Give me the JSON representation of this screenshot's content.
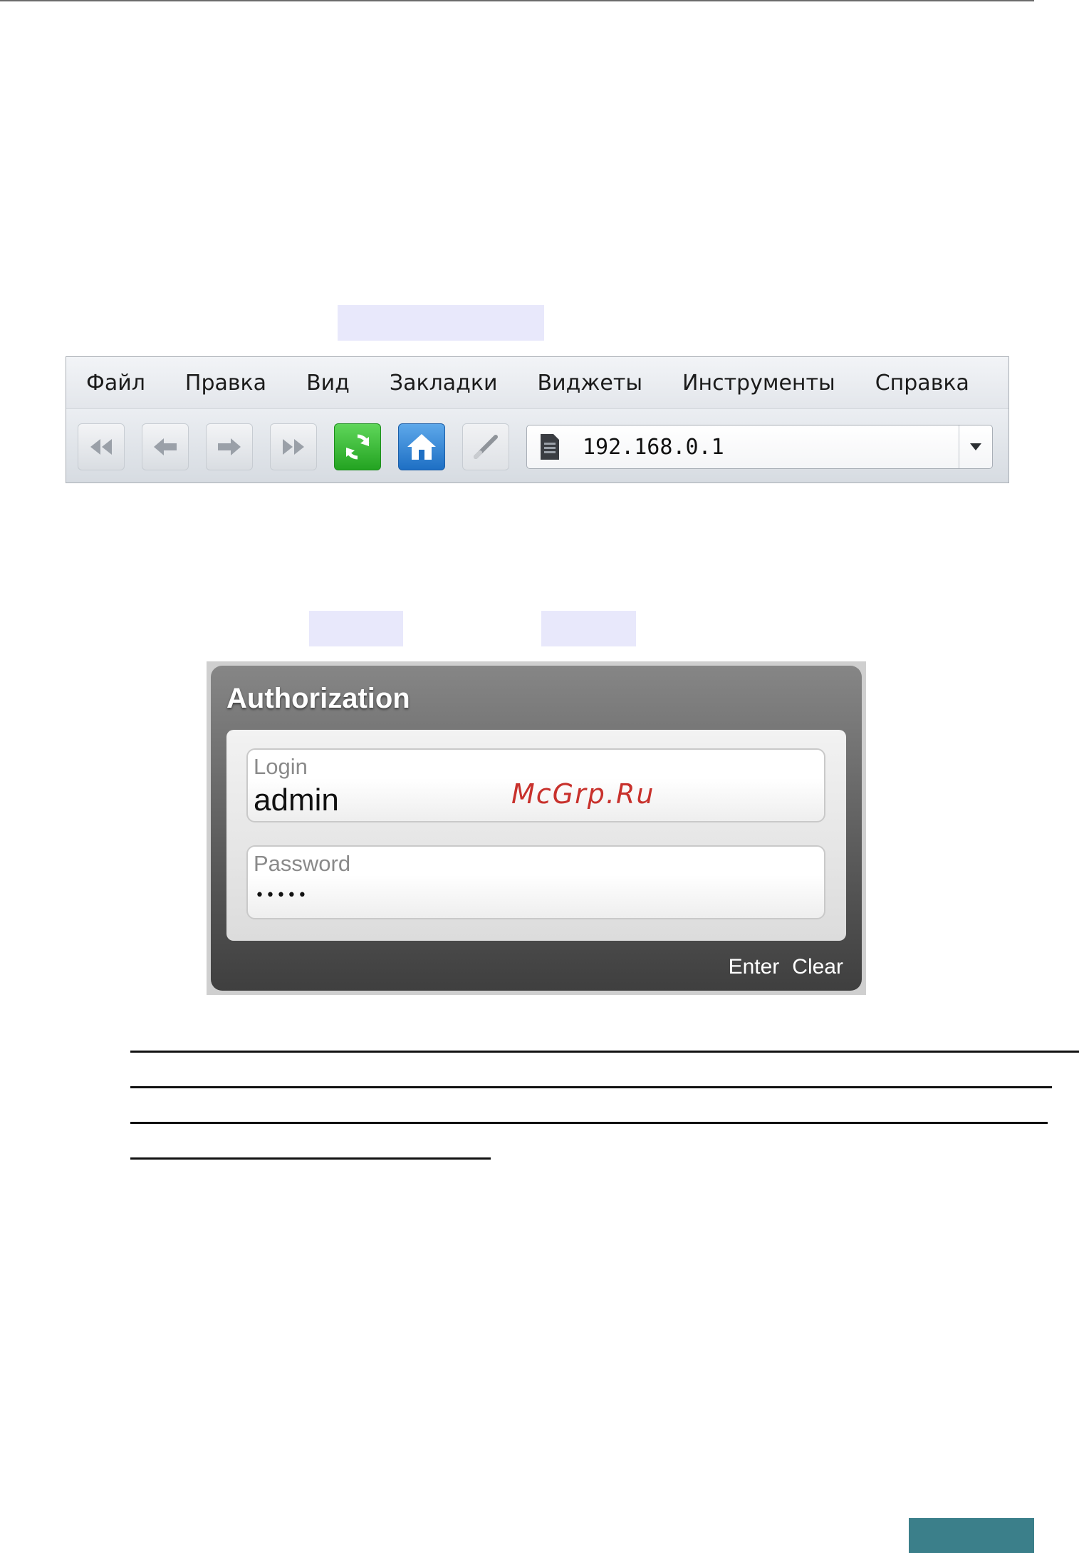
{
  "browser": {
    "menu": [
      "Файл",
      "Правка",
      "Вид",
      "Закладки",
      "Виджеты",
      "Инструменты",
      "Справка"
    ],
    "toolbar_icons": [
      "rewind-icon",
      "back-arrow-icon",
      "forward-arrow-icon",
      "fast-forward-icon",
      "refresh-icon",
      "home-icon",
      "edit-icon"
    ],
    "address": "192.168.0.1"
  },
  "auth": {
    "title": "Authorization",
    "login_label": "Login",
    "login_value": "admin",
    "password_label": "Password",
    "password_value": "•••••",
    "enter_label": "Enter",
    "clear_label": "Clear"
  },
  "watermark": "McGrp.Ru",
  "colors": {
    "highlight": "#e8e8fb",
    "footer_tab": "#3b7f8a",
    "refresh_green": "#23a321",
    "home_blue": "#1e6fc4"
  }
}
